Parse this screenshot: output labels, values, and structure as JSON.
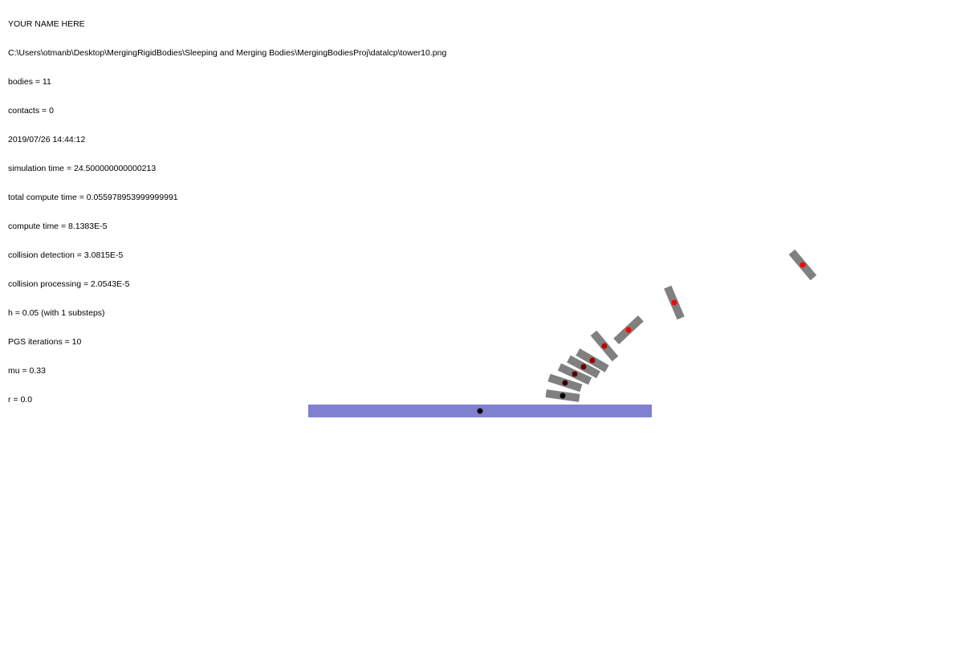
{
  "info": {
    "lines": [
      "YOUR NAME HERE",
      "C:\\Users\\otmanb\\Desktop\\MergingRigidBodies\\Sleeping and Merging Bodies\\MergingBodiesProj\\datalcp\\tower10.png",
      "bodies = 11",
      "contacts = 0",
      "2019/07/26 14:44:12",
      "simulation time = 24.500000000000213",
      "total compute time = 0.055978953999999991",
      "compute time = 8.1383E-5",
      "collision detection = 3.0815E-5",
      "collision processing = 2.0543E-5",
      "h = 0.05 (with 1 substeps)",
      "PGS iterations = 10",
      "mu = 0.33",
      "r = 0.0"
    ]
  },
  "colors": {
    "ground": "#8080d0",
    "block": "#808080",
    "background": "#ffffff",
    "center_red": "#ff0000",
    "center_dark_red": "#8b0000",
    "center_black": "#000000"
  }
}
